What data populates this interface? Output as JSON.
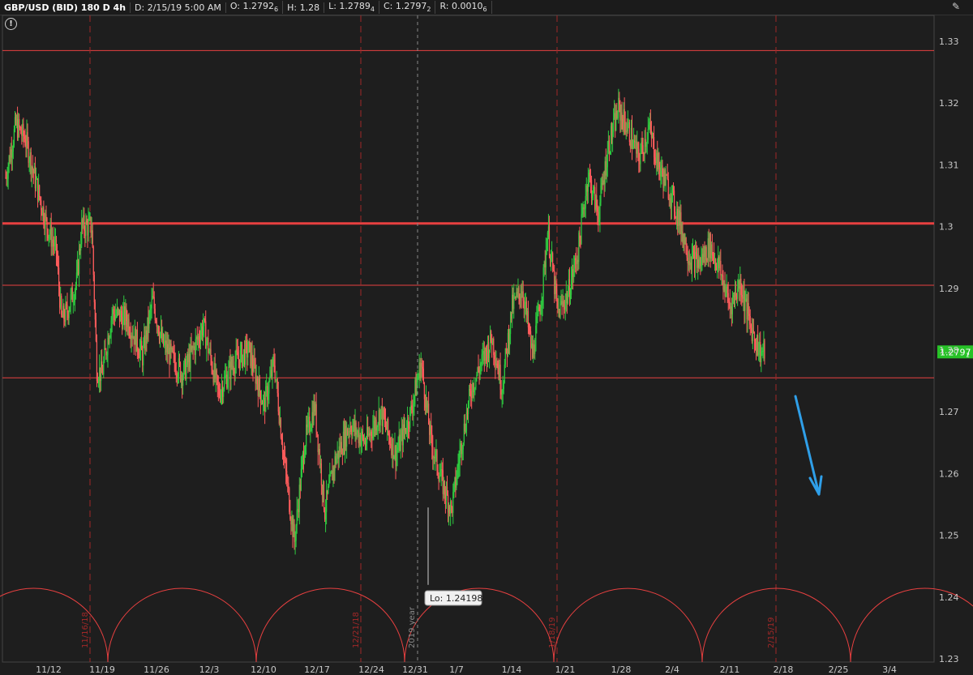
{
  "header": {
    "symbol": "GBP/USD (BID) 180 D 4h",
    "date": "D: 2/15/19 5:00 AM",
    "open": "O: 1.2792",
    "open_sub": "6",
    "high": "H: 1.28",
    "low": "L: 1.2789",
    "low_sub": "4",
    "close": "C: 1.2797",
    "close_sub": "2",
    "range": "R: 0.0010",
    "range_sub": "6"
  },
  "icons": {
    "settings": "wrench-settings-icon",
    "info": "info-circle-icon"
  },
  "colors": {
    "background": "#1e1e1e",
    "up_candle": "#2ecc40",
    "down_candle": "#ff5c5c",
    "level_line": "#e84040",
    "cycle": "#e84040",
    "cycle_marker": "#a02828",
    "arrow": "#2f9fe8",
    "price_badge": "#27c227"
  },
  "chart_data": {
    "type": "candlestick",
    "timeframe": "4h",
    "ylim": [
      1.23,
      1.335
    ],
    "y_ticks": [
      "1.33",
      "1.32",
      "1.31",
      "1.3",
      "1.29",
      "1.28",
      "1.27",
      "1.26",
      "1.25",
      "1.24",
      "1.23"
    ],
    "x_ticks": [
      "11/12",
      "11/19",
      "11/26",
      "12/3",
      "12/10",
      "12/17",
      "12/24",
      "12/31",
      "1/7",
      "1/14",
      "1/21",
      "1/28",
      "2/4",
      "2/11",
      "2/18",
      "2/25",
      "3/4"
    ],
    "price_path": [
      [
        0,
        1.308
      ],
      [
        2,
        1.3165
      ],
      [
        4,
        1.314
      ],
      [
        6,
        1.307
      ],
      [
        8,
        1.3005
      ],
      [
        10,
        1.296
      ],
      [
        11,
        1.285
      ],
      [
        12,
        1.286
      ],
      [
        14,
        1.291
      ],
      [
        15,
        1.3
      ],
      [
        17,
        1.3
      ],
      [
        18,
        1.277
      ],
      [
        19,
        1.276
      ],
      [
        21,
        1.286
      ],
      [
        24,
        1.285
      ],
      [
        27,
        1.279
      ],
      [
        29,
        1.288
      ],
      [
        31,
        1.281
      ],
      [
        35,
        1.276
      ],
      [
        39,
        1.284
      ],
      [
        42,
        1.273
      ],
      [
        45,
        1.278
      ],
      [
        48,
        1.28
      ],
      [
        51,
        1.271
      ],
      [
        53,
        1.278
      ],
      [
        55,
        1.262
      ],
      [
        57,
        1.249
      ],
      [
        59,
        1.265
      ],
      [
        61,
        1.271
      ],
      [
        63,
        1.254
      ],
      [
        65,
        1.262
      ],
      [
        68,
        1.268
      ],
      [
        71,
        1.265
      ],
      [
        74,
        1.27
      ],
      [
        77,
        1.263
      ],
      [
        80,
        1.27
      ],
      [
        82,
        1.278
      ],
      [
        84,
        1.265
      ],
      [
        86,
        1.259
      ],
      [
        88,
        1.254
      ],
      [
        90,
        1.265
      ],
      [
        92,
        1.274
      ],
      [
        94,
        1.278
      ],
      [
        96,
        1.282
      ],
      [
        98,
        1.274
      ],
      [
        100,
        1.287
      ],
      [
        102,
        1.29
      ],
      [
        104,
        1.279
      ],
      [
        106,
        1.29
      ],
      [
        107,
        1.2995
      ],
      [
        109,
        1.286
      ],
      [
        111,
        1.289
      ],
      [
        113,
        1.296
      ],
      [
        115,
        1.3085
      ],
      [
        117,
        1.302
      ],
      [
        119,
        1.313
      ],
      [
        121,
        1.319
      ],
      [
        123,
        1.3155
      ],
      [
        125,
        1.311
      ],
      [
        127,
        1.316
      ],
      [
        129,
        1.3095
      ],
      [
        131,
        1.306
      ],
      [
        133,
        1.301
      ],
      [
        135,
        1.295
      ],
      [
        137,
        1.294
      ],
      [
        139,
        1.297
      ],
      [
        141,
        1.293
      ],
      [
        143,
        1.287
      ],
      [
        145,
        1.291
      ],
      [
        147,
        1.284
      ],
      [
        149,
        1.2797
      ]
    ],
    "candle_count": 150,
    "horizontal_levels": [
      {
        "value": 1.3285,
        "width": 1
      },
      {
        "value": 1.3005,
        "width": 3
      },
      {
        "value": 1.2905,
        "width": 1
      },
      {
        "value": 1.2755,
        "width": 1
      }
    ],
    "cycle_markers": [
      "11/16/18",
      "12/21/18",
      "1/18/19",
      "2/15/19"
    ],
    "year_marker": "2019 year",
    "low_annotation": {
      "label": "Lo: 1.24198",
      "value": 1.24198
    },
    "current_price": {
      "main": "1.2797",
      "sub": "2",
      "value": 1.2797
    },
    "projection_arrow": {
      "from": [
        1.2765
      ],
      "to": [
        1.256
      ]
    }
  }
}
